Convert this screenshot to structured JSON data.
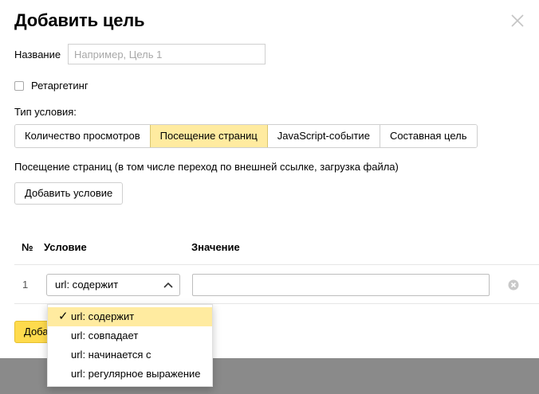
{
  "dialog": {
    "title": "Добавить цель",
    "name_label": "Название",
    "name_placeholder": "Например, Цель 1",
    "name_value": "",
    "retargeting_label": "Ретаргетинг",
    "retargeting_checked": false,
    "condition_type_label": "Тип условия:",
    "tabs": [
      {
        "label": "Количество просмотров",
        "active": false
      },
      {
        "label": "Посещение страниц",
        "active": true
      },
      {
        "label": "JavaScript-событие",
        "active": false
      },
      {
        "label": "Составная цель",
        "active": false
      }
    ],
    "description": "Посещение страниц (в том числе переход по внешней ссылке, загрузка файла)",
    "add_condition_label": "Добавить условие",
    "table": {
      "headers": {
        "num": "№",
        "condition": "Условие",
        "value": "Значение"
      },
      "rows": [
        {
          "num": "1",
          "condition": "url: содержит",
          "value": ""
        }
      ]
    },
    "save_label": "Добавить цель",
    "dropdown": {
      "options": [
        {
          "label": "url: содержит",
          "selected": true
        },
        {
          "label": "url: совпадает",
          "selected": false
        },
        {
          "label": "url: начинается с",
          "selected": false
        },
        {
          "label": "url: регулярное выражение",
          "selected": false
        }
      ],
      "check_glyph": "✓"
    }
  },
  "colors": {
    "accent_yellow": "#ffdb4d",
    "selected_yellow": "#ffeba0",
    "overlay": "#8a8a8a"
  },
  "icons": [
    "close-icon",
    "chevron-up-icon",
    "clear-icon",
    "checkmark-icon"
  ]
}
